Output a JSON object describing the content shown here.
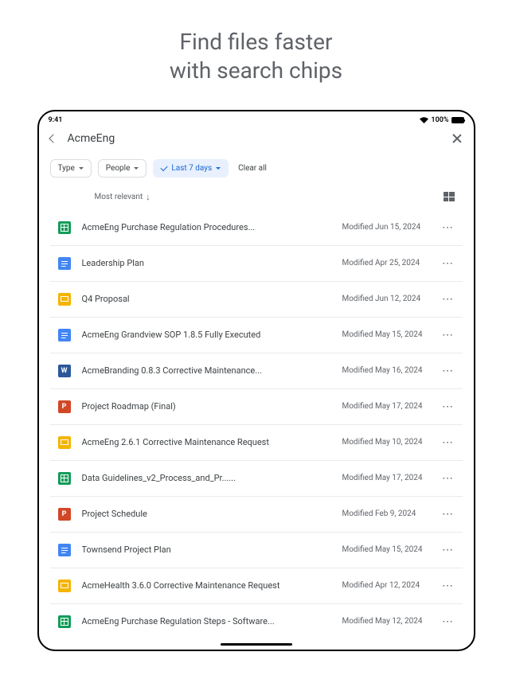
{
  "promo": {
    "line1": "Find files faster",
    "line2": "with search chips"
  },
  "statusBar": {
    "time": "9:41",
    "batteryText": "100%"
  },
  "header": {
    "title": "AcmeEng"
  },
  "chips": {
    "type": "Type",
    "people": "People",
    "active": "Last 7 days",
    "clearAll": "Clear all"
  },
  "listHeader": {
    "sortLabel": "Most relevant"
  },
  "files": [
    {
      "icon": "sheets",
      "name": "AcmeEng Purchase Regulation Procedures...",
      "modified": "Modified Jun 15, 2024"
    },
    {
      "icon": "docs",
      "name": "Leadership Plan",
      "modified": "Modified Apr 25, 2024"
    },
    {
      "icon": "slides",
      "name": "Q4 Proposal",
      "modified": "Modified Jun 12, 2024"
    },
    {
      "icon": "docs",
      "name": "AcmeEng Grandview SOP 1.8.5 Fully Executed",
      "modified": "Modified May 15, 2024"
    },
    {
      "icon": "word",
      "name": "AcmeBranding 0.8.3 Corrective Maintenance...",
      "modified": "Modified May 16, 2024"
    },
    {
      "icon": "ppt",
      "name": "Project Roadmap (Final)",
      "modified": "Modified May 17, 2024"
    },
    {
      "icon": "slides",
      "name": "AcmeEng 2.6.1 Corrective Maintenance Request",
      "modified": "Modified May 10, 2024"
    },
    {
      "icon": "sheets",
      "name": "Data Guidelines_v2_Process_and_Pr......",
      "modified": "Modified May 17, 2024"
    },
    {
      "icon": "ppt",
      "name": "Project Schedule",
      "modified": "Modified Feb 9, 2024"
    },
    {
      "icon": "docs",
      "name": "Townsend Project Plan",
      "modified": "Modified May 15, 2024"
    },
    {
      "icon": "slides",
      "name": "AcmeHealth 3.6.0 Corrective Maintenance Request",
      "modified": "Modified Apr 12, 2024"
    },
    {
      "icon": "sheets",
      "name": "AcmeEng Purchase Regulation Steps - Software...",
      "modified": "Modified May 12, 2024"
    }
  ]
}
